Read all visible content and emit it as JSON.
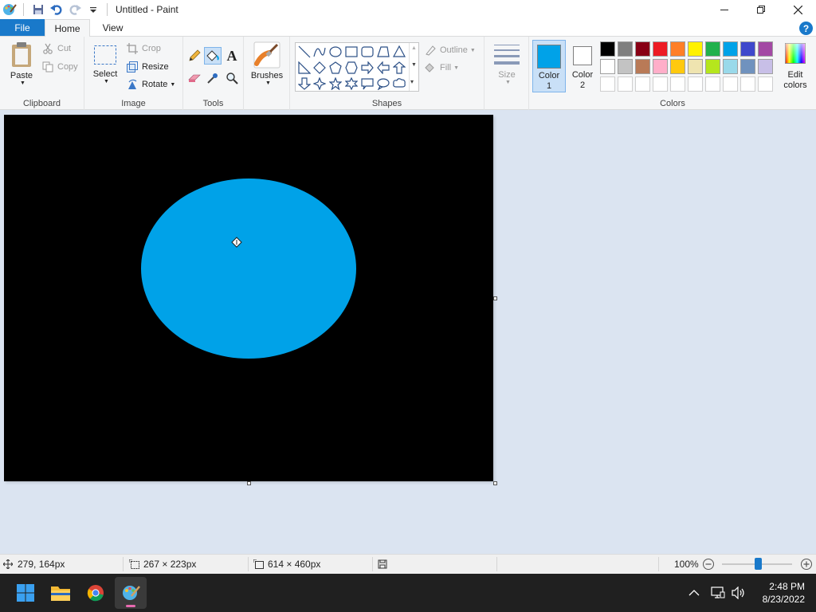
{
  "window": {
    "title": "Untitled - Paint"
  },
  "tabs": {
    "file": "File",
    "home": "Home",
    "view": "View",
    "help": "?"
  },
  "ribbon": {
    "clipboard": {
      "label": "Clipboard",
      "paste": "Paste",
      "cut": "Cut",
      "copy": "Copy"
    },
    "image": {
      "label": "Image",
      "select": "Select",
      "crop": "Crop",
      "resize": "Resize",
      "rotate": "Rotate"
    },
    "tools": {
      "label": "Tools"
    },
    "brushes": {
      "label": "Brushes"
    },
    "shapes": {
      "label": "Shapes",
      "outline": "Outline",
      "fill": "Fill"
    },
    "size": {
      "label": "Size"
    },
    "colors": {
      "label": "Colors",
      "color1_line1": "Color",
      "color1_line2": "1",
      "color2_line1": "Color",
      "color2_line2": "2",
      "edit_line1": "Edit",
      "edit_line2": "colors",
      "color1": "#00a2e8",
      "color2": "#ffffff",
      "palette_row1": [
        "#000000",
        "#7f7f7f",
        "#880015",
        "#ed1c24",
        "#ff7f27",
        "#fff200",
        "#22b14c",
        "#00a2e8",
        "#3f48cc",
        "#a349a4"
      ],
      "palette_row2": [
        "#ffffff",
        "#c3c3c3",
        "#b97a57",
        "#ffaec9",
        "#ffc90e",
        "#efe4b0",
        "#b5e61d",
        "#99d9ea",
        "#7092be",
        "#c8bfe7"
      ]
    }
  },
  "canvas": {
    "background": "#000000",
    "ellipse_color": "#00a2e8"
  },
  "status": {
    "cursor_pos": "279, 164px",
    "selection_size": "267 × 223px",
    "canvas_size": "614 × 460px",
    "zoom": "100%",
    "zoom_level_fraction": 0.5
  },
  "taskbar": {
    "time": "2:48 PM",
    "date": "8/23/2022"
  }
}
